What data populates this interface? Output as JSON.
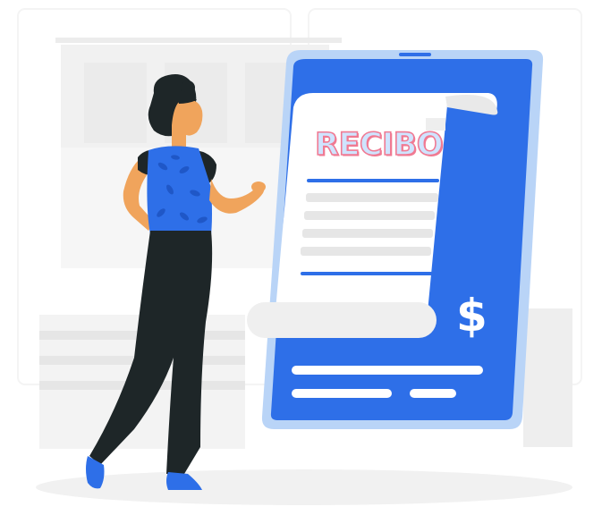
{
  "receipt": {
    "title": "RECIBO",
    "currency_symbol": "$"
  },
  "colors": {
    "primary_blue": "#2e6fe8",
    "tablet_border": "#b9d4f7",
    "paper": "#ffffff",
    "figure_dark": "#1e2628",
    "skin": "#f0a45c",
    "background_shape": "#f0f0f0",
    "title_fill": "#cfe4ff",
    "title_outline": "#f07a93"
  }
}
